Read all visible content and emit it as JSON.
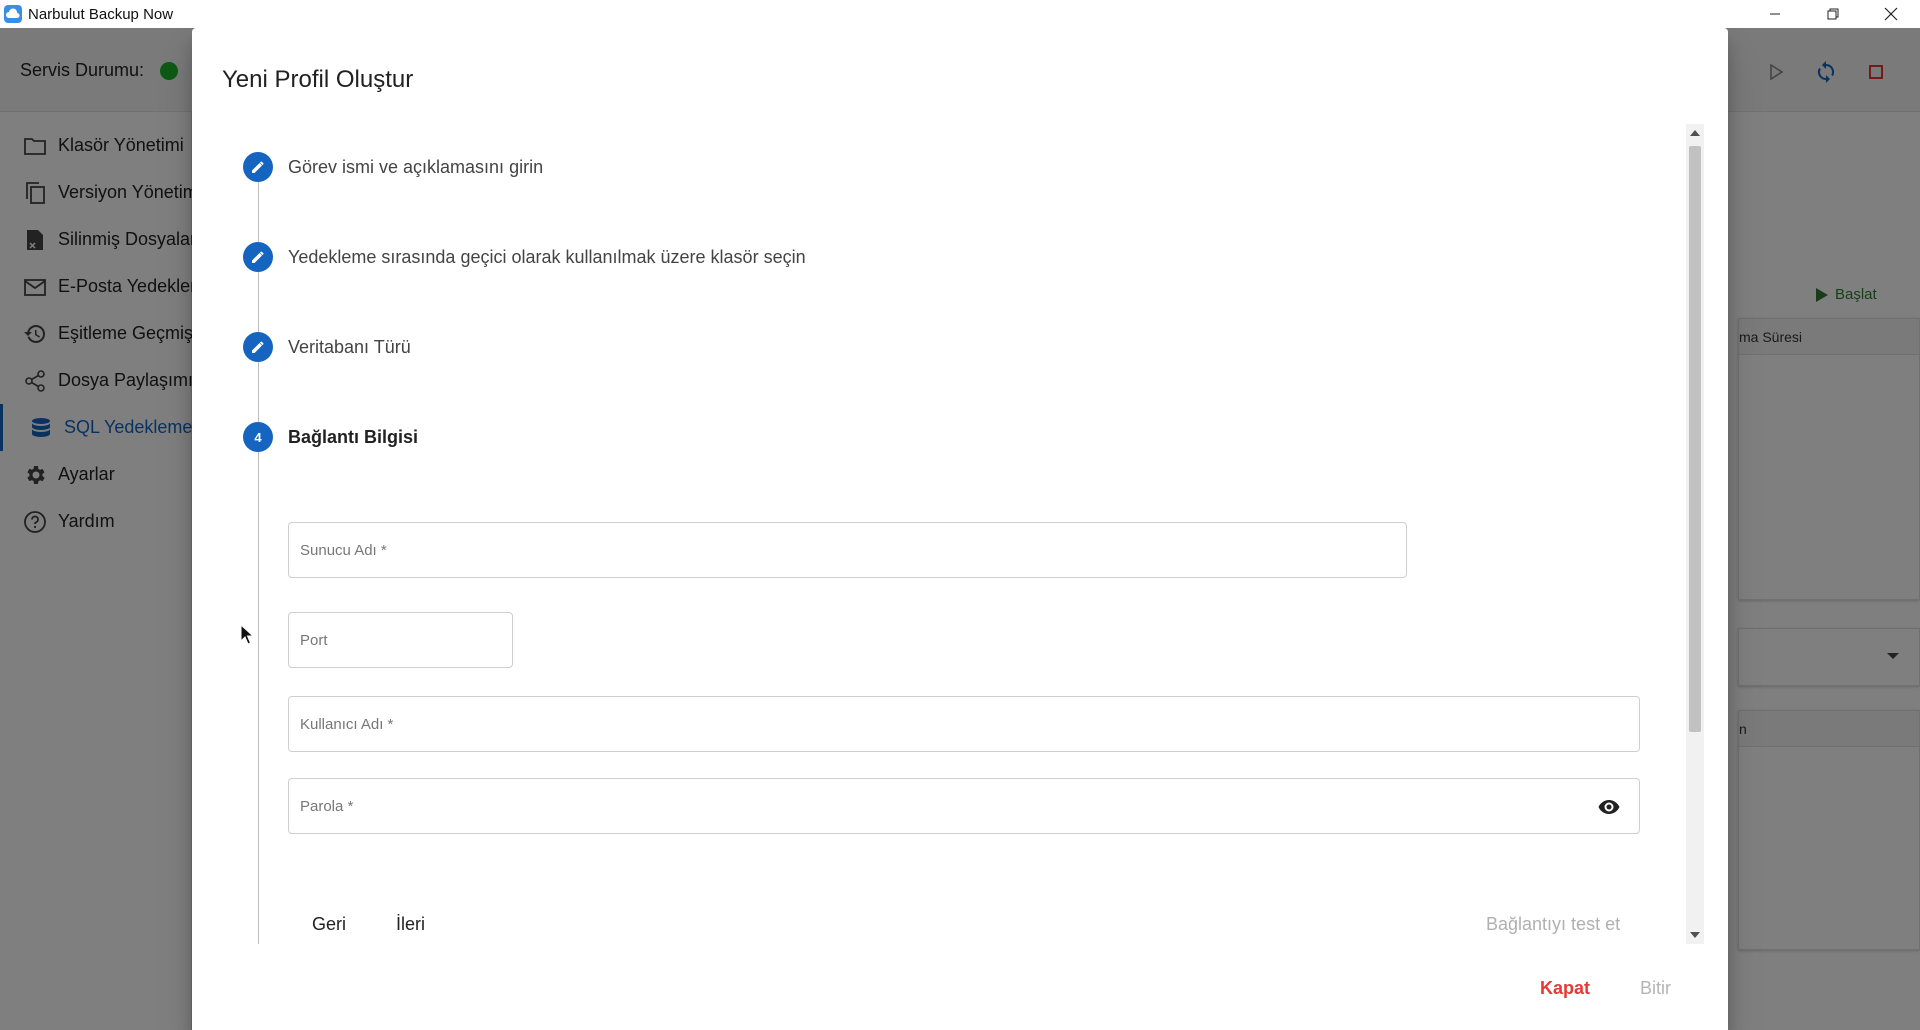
{
  "window": {
    "title": "Narbulut Backup Now",
    "controls": [
      "minimize",
      "restore",
      "close"
    ]
  },
  "toolbar": {
    "service_label": "Servis Durumu:",
    "service_status_color": "#1db32a"
  },
  "sidebar": {
    "items": [
      {
        "label": "Klasör Yönetimi",
        "icon": "folder-icon"
      },
      {
        "label": "Versiyon Yönetimi",
        "icon": "copy-icon"
      },
      {
        "label": "Silinmiş Dosyalar",
        "icon": "deleted-file-icon"
      },
      {
        "label": "E-Posta Yedekleme",
        "icon": "mail-icon"
      },
      {
        "label": "Eşitleme Geçmişi",
        "icon": "history-icon"
      },
      {
        "label": "Dosya Paylaşımı",
        "icon": "share-icon"
      },
      {
        "label": "SQL Yedekleme",
        "icon": "database-icon",
        "active": true
      },
      {
        "label": "Ayarlar",
        "icon": "gear-icon"
      },
      {
        "label": "Yardım",
        "icon": "help-icon"
      }
    ]
  },
  "background": {
    "start_label": "Başlat",
    "table_header_1": "ma Süresi",
    "table_header_2": "n"
  },
  "dialog": {
    "title": "Yeni Profil Oluştur",
    "steps": [
      {
        "label": "Görev ismi ve açıklamasını girin",
        "state": "edit"
      },
      {
        "label": "Yedekleme sırasında geçici olarak kullanılmak üzere klasör seçin",
        "state": "edit"
      },
      {
        "label": "Veritabanı Türü",
        "state": "edit"
      },
      {
        "label": "Bağlantı Bilgisi",
        "state": "active",
        "number": "4"
      }
    ],
    "fields": {
      "server_placeholder": "Sunucu Adı *",
      "port_placeholder": "Port",
      "username_placeholder": "Kullanıcı Adı *",
      "password_placeholder": "Parola *"
    },
    "step_actions": {
      "back": "Geri",
      "next": "İleri",
      "test": "Bağlantıyı test et"
    },
    "footer": {
      "close": "Kapat",
      "finish": "Bitir"
    },
    "accent_color": "#1565c0"
  }
}
